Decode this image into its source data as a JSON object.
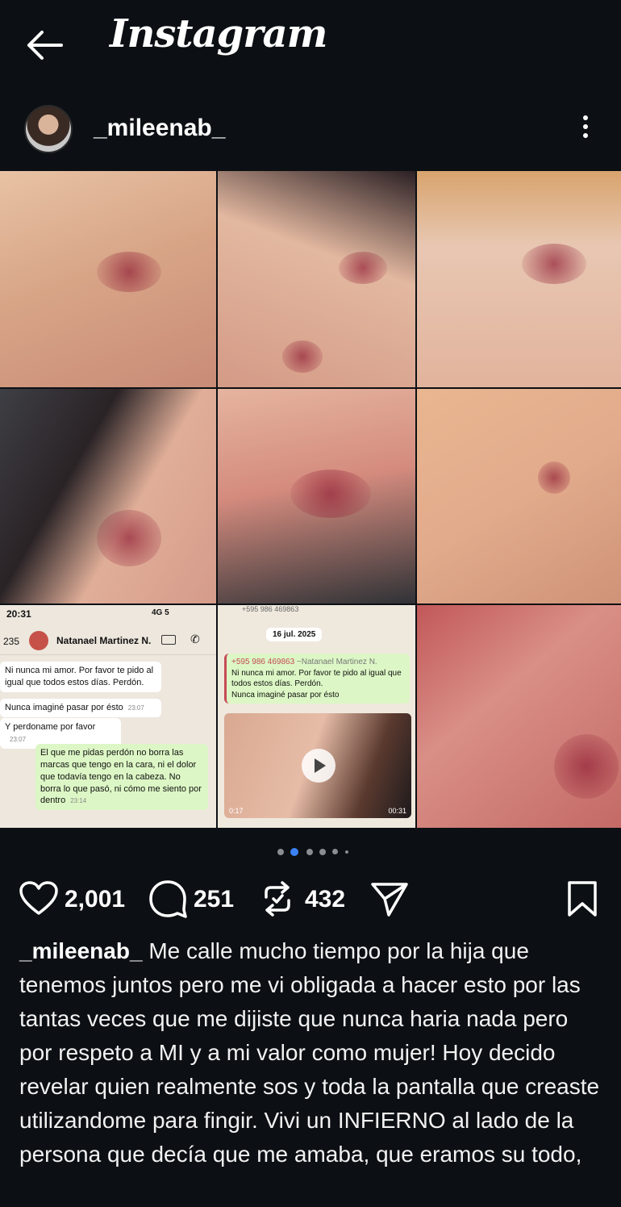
{
  "app": {
    "title": "Instagram"
  },
  "post": {
    "username": "_mileenab_",
    "likes": "2,001",
    "comments": "251",
    "reposts": "432",
    "caption_user": "_mileenab_",
    "caption_text": "Me calle mucho tiempo por la hija que tenemos juntos pero me vi obligada a hacer esto por las tantas veces que me dijiste que nunca haria nada pero por respeto a MI y a mi valor como mujer! Hoy decido revelar quien realmente  sos y toda la pantalla que creaste utilizandome para fingir. Vivi un INFIERNO al lado de la persona que decía que me amaba, que eramos su todo,"
  },
  "carousel": {
    "count": 6,
    "active_index": 1
  },
  "chat_screenshot": {
    "status_time": "20:31",
    "status_signal": "4G",
    "status_battery": "5",
    "back_count": "235",
    "contact_name": "Natanael Martinez N.",
    "messages": [
      {
        "text": "Ni nunca mi amor. Por favor te pido al igual que todos estos días. Perdón.",
        "time": ""
      },
      {
        "text": "Nunca imaginé pasar por ésto",
        "time": "23:07"
      },
      {
        "text": "Y perdoname por favor",
        "time": "23:07"
      },
      {
        "text": "El que me pidas perdón no borra las marcas que tengo en la cara, ni el dolor que todavía tengo en la cabeza. No borra lo que pasó, ni cómo me siento por dentro",
        "time": "23:14"
      }
    ]
  },
  "chat_screenshot_2": {
    "top_partial": "+595 986 469863",
    "date": "16 jul. 2025",
    "forward_number": "+595 986 469863",
    "forward_name": "~Natanael Martinez N.",
    "forward_line1": "Ni nunca mi amor. Por favor te pido al igual que todos estos días. Perdón.",
    "forward_line2": "Nunca imaginé pasar por ésto",
    "video_start": "0:17",
    "video_end": "00:31"
  },
  "colors": {
    "background": "#0c1014",
    "text": "#f5f5f5",
    "active_dot": "#3b82f6"
  }
}
